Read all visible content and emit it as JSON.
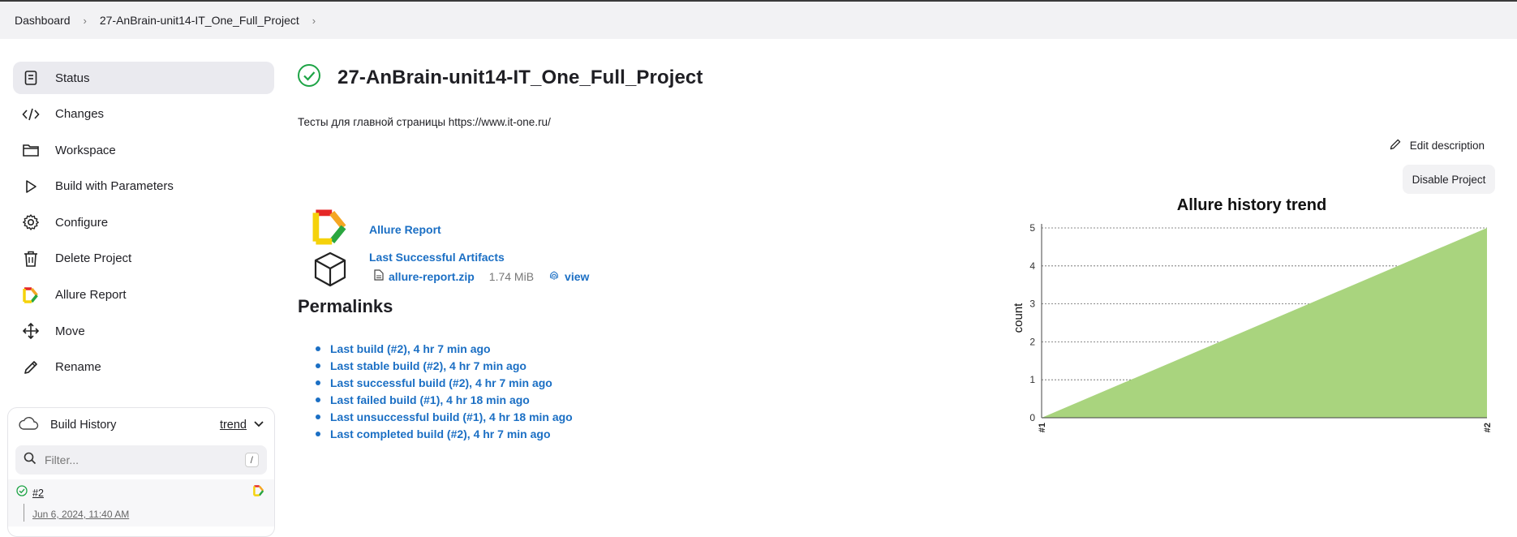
{
  "breadcrumb": {
    "items": [
      "Dashboard",
      "27-AnBrain-unit14-IT_One_Full_Project"
    ]
  },
  "sidebar": {
    "items": [
      {
        "label": "Status",
        "icon": "status-icon",
        "active": true
      },
      {
        "label": "Changes",
        "icon": "code-icon"
      },
      {
        "label": "Workspace",
        "icon": "folder-icon"
      },
      {
        "label": "Build with Parameters",
        "icon": "play-icon"
      },
      {
        "label": "Configure",
        "icon": "gear-icon"
      },
      {
        "label": "Delete Project",
        "icon": "trash-icon"
      },
      {
        "label": "Allure Report",
        "icon": "allure-icon"
      },
      {
        "label": "Move",
        "icon": "move-icon"
      },
      {
        "label": "Rename",
        "icon": "pencil-icon"
      }
    ]
  },
  "build_history": {
    "title": "Build History",
    "trend_label": "trend",
    "filter_placeholder": "Filter...",
    "filter_shortcut": "/",
    "builds": [
      {
        "number": "#2",
        "date": "Jun 6, 2024, 11:40 AM",
        "status": "success"
      }
    ]
  },
  "main": {
    "title": "27-AnBrain-unit14-IT_One_Full_Project",
    "description": "Тесты для главной страницы https://www.it-one.ru/",
    "edit_description": "Edit description",
    "disable_project": "Disable Project",
    "allure_report": "Allure Report",
    "artifacts": {
      "title": "Last Successful Artifacts",
      "file": "allure-report.zip",
      "size": "1.74 MiB",
      "view": "view"
    },
    "permalinks_title": "Permalinks",
    "permalinks": [
      "Last build (#2), 4 hr 7 min ago",
      "Last stable build (#2), 4 hr 7 min ago",
      "Last successful build (#2), 4 hr 7 min ago",
      "Last failed build (#1), 4 hr 18 min ago",
      "Last unsuccessful build (#1), 4 hr 18 min ago",
      "Last completed build (#2), 4 hr 7 min ago"
    ]
  },
  "colors": {
    "accent": "#1b6fc4",
    "success": "#1ea446",
    "area": "#a9d47e"
  },
  "chart_data": {
    "type": "area",
    "title": "Allure history trend",
    "ylabel": "count",
    "xlabel": "",
    "categories": [
      "#1",
      "#2"
    ],
    "series": [
      {
        "values": [
          0,
          5
        ]
      }
    ],
    "ylim": [
      0,
      5
    ],
    "yticks": [
      0,
      1,
      2,
      3,
      4,
      5
    ],
    "grid": true
  }
}
